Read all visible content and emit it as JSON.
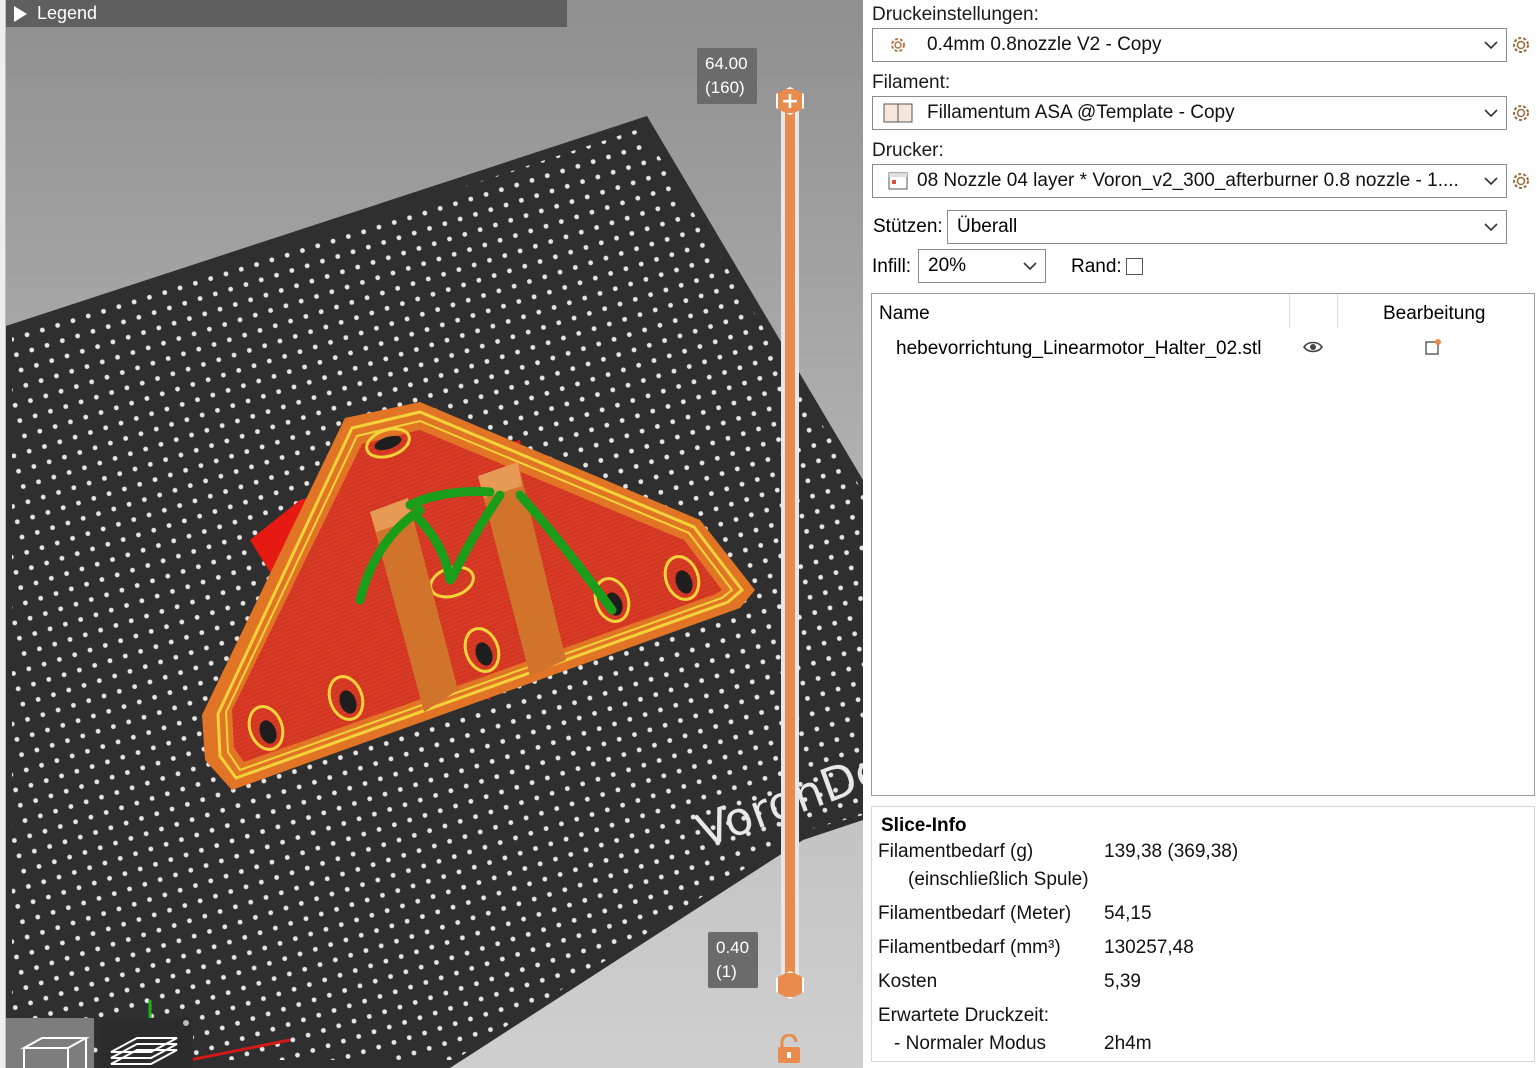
{
  "legend": {
    "label": "Legend"
  },
  "layer_slider": {
    "top_value": "64.00",
    "top_layer": "(160)",
    "bottom_value": "0.40",
    "bottom_layer": "(1)",
    "accent": "#e98b4c"
  },
  "bed": {
    "brand_text": "VoronDe"
  },
  "sidebar": {
    "print_settings_label": "Druckeinstellungen:",
    "print_settings_value": "0.4mm 0.8nozzle V2 - Copy",
    "filament_label": "Filament:",
    "filament_value": "Fillamentum ASA @Template - Copy",
    "printer_label": "Drucker:",
    "printer_value": "08 Nozzle 04 layer * Voron_v2_300_afterburner 0.8 nozzle - 1....",
    "supports_label": "Stützen:",
    "supports_value": "Überall",
    "infill_label": "Infill:",
    "infill_value": "20%",
    "brim_label": "Rand:",
    "brim_checked": false
  },
  "objects": {
    "col_name": "Name",
    "col_edit": "Bearbeitung",
    "rows": [
      {
        "name": "hebevorrichtung_Linearmotor_Halter_02.stl"
      }
    ]
  },
  "slice_info": {
    "title": "Slice-Info",
    "rows": [
      {
        "label": "Filamentbedarf (g)",
        "value": "139,38 (369,38)"
      },
      {
        "label": "(einschließlich Spule)",
        "value": ""
      },
      {
        "label": "Filamentbedarf (Meter)",
        "value": "54,15"
      },
      {
        "label": "Filamentbedarf (mm³)",
        "value": "130257,48"
      },
      {
        "label": "Kosten",
        "value": "5,39"
      },
      {
        "label": "Erwartete Druckzeit:",
        "value": ""
      },
      {
        "label": "- Normaler Modus",
        "value": "2h4m"
      }
    ]
  }
}
